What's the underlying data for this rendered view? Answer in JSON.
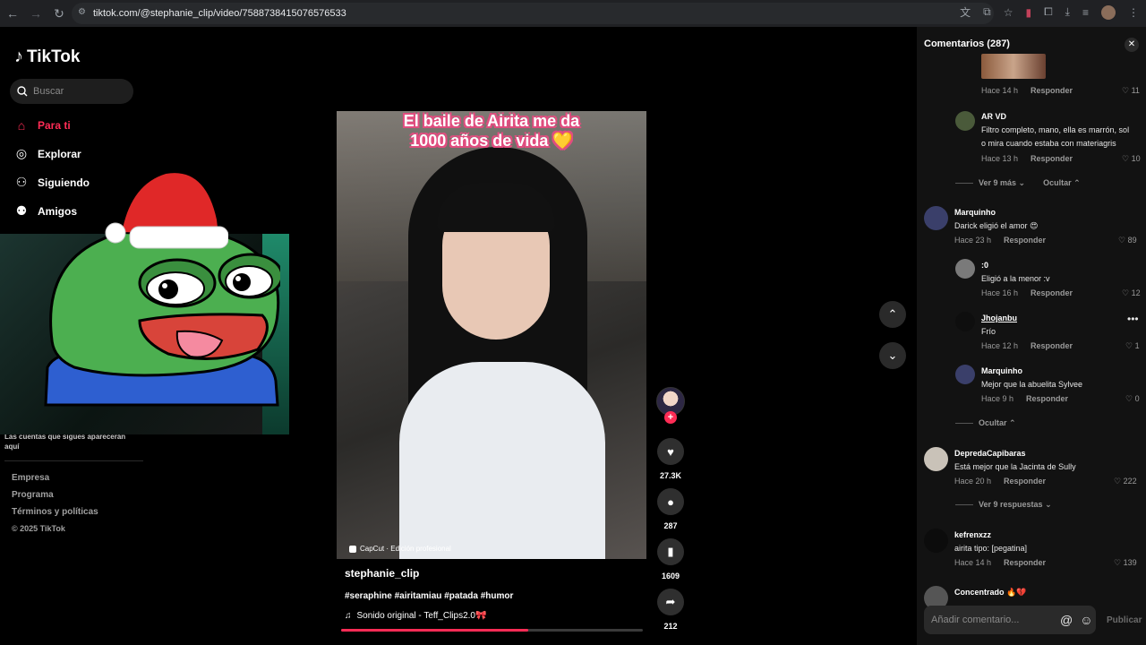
{
  "browser": {
    "url": "tiktok.com/@stephanie_clip/video/7588738415076576533",
    "back_icon": "arrow-left-icon",
    "forward_icon": "arrow-right-icon",
    "reload_icon": "reload-icon"
  },
  "sidebar": {
    "logo": "TikTok",
    "search_placeholder": "Buscar",
    "nav": [
      {
        "label": "Para ti",
        "icon": "home-icon",
        "active": true
      },
      {
        "label": "Explorar",
        "icon": "compass-icon",
        "active": false
      },
      {
        "label": "Siguiendo",
        "icon": "following-icon",
        "active": false
      },
      {
        "label": "Amigos",
        "icon": "friends-icon",
        "active": false
      }
    ],
    "follow_note": "Las cuentas que sigues aparecerán aquí",
    "footer": {
      "empresa": "Empresa",
      "programa": "Programa",
      "terminos": "Términos y políticas",
      "copyright": "© 2025 TikTok"
    }
  },
  "video": {
    "caption_overlay": "El baile de Airita me da 1000 años de vida 💛",
    "capcut_label": "CapCut · Edición profesional",
    "username": "stephanie_clip",
    "hashtags": "#seraphine #airitamiau #patada #humor",
    "sound": "Sonido original - Teff_Clips2.0🎀",
    "progress": 0.62
  },
  "actions": {
    "likes": "27.3K",
    "comments": "287",
    "saves": "1609",
    "shares": "212"
  },
  "comments_panel": {
    "title": "Comentarios (287)",
    "input_placeholder": "Añadir comentario...",
    "publish_label": "Publicar",
    "reply_label": "Responder",
    "items": [
      {
        "name": "",
        "text": "",
        "time": "Hace 14 h",
        "likes": "11"
      },
      {
        "name": "AR VD",
        "text1": "Filtro completo, mano, ella es marrón, sol",
        "text2": "o mira cuando estaba con materiagris",
        "time": "Hace 13 h",
        "likes": "10"
      },
      {
        "name": "Marquinho",
        "text": "Darick eligió el amor 😍",
        "time": "Hace 23 h",
        "likes": "89"
      },
      {
        "name": ":0",
        "text": "Eligió a la menor :v",
        "time": "Hace 16 h",
        "likes": "12"
      },
      {
        "name": "Jhojanbu",
        "text": "Frío",
        "time": "Hace 12 h",
        "likes": "1"
      },
      {
        "name": "Marquinho",
        "text": "Mejor que la abuelita Sylvee",
        "time": "Hace 9 h",
        "likes": "0"
      },
      {
        "name": "DepredaCapibaras",
        "text": "Está mejor que la Jacinta de Sully",
        "time": "Hace 20 h",
        "likes": "222"
      },
      {
        "name": "kefrenxzz",
        "text": "airita tipo: [pegatina]",
        "time": "Hace 14 h",
        "likes": "139"
      },
      {
        "name": "Concentrado 🔥💔",
        "text": "",
        "time": "",
        "likes": ""
      }
    ],
    "threads": {
      "ver_mas": "Ver 9 más",
      "ocultar": "Ocultar",
      "ocultar2": "Ocultar",
      "ver_respuestas": "Ver 9 respuestas"
    }
  }
}
